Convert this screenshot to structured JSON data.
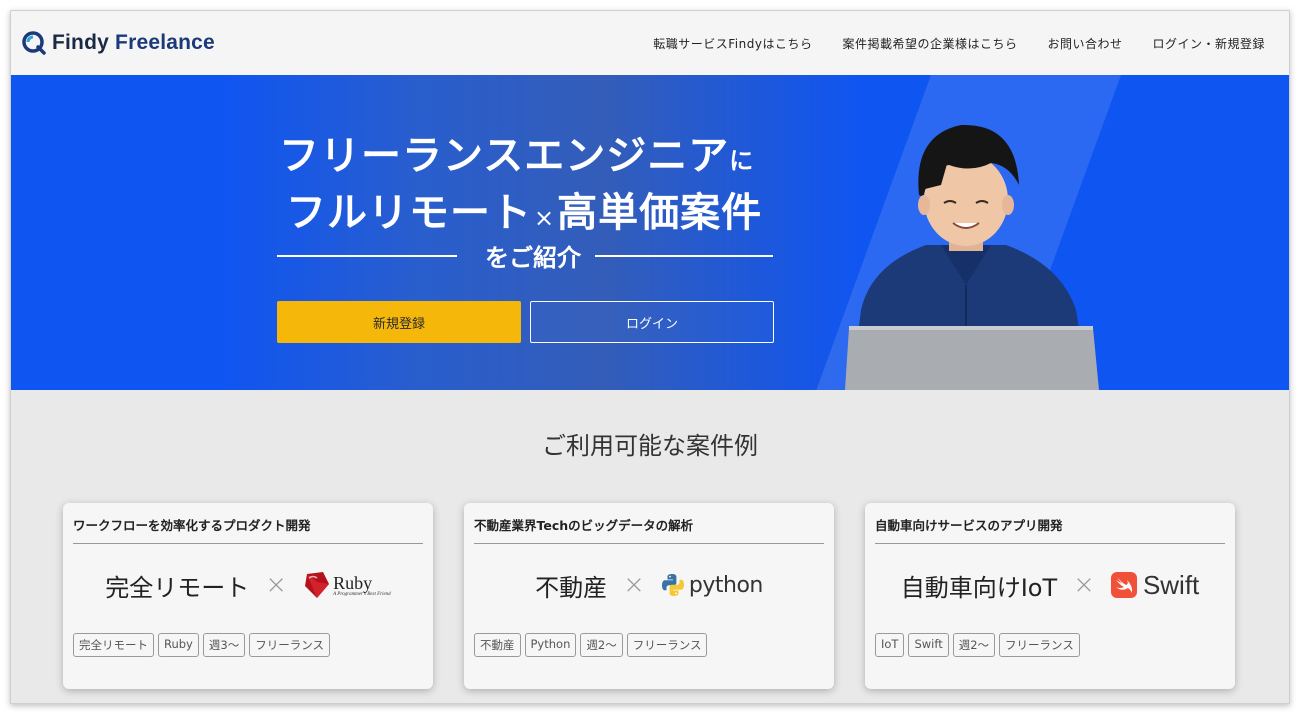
{
  "header": {
    "logo_part1": "Findy",
    "logo_part2": "Freelance",
    "nav": [
      "転職サービスFindyはこちら",
      "案件掲載希望の企業様はこちら",
      "お問い合わせ",
      "ログイン・新規登録"
    ]
  },
  "hero": {
    "title1_main": "フリーランスエンジニア",
    "title1_suffix": "に",
    "title2_left": "フルリモート",
    "title2_x": "×",
    "title2_right": "高単価案件",
    "subtitle": "をご紹介",
    "register_label": "新規登録",
    "login_label": "ログイン",
    "brand_color": "#0f55f2",
    "cta_color": "#f5b80a"
  },
  "section": {
    "title": "ご利用可能な案件例"
  },
  "cards": [
    {
      "title": "ワークフローを効率化するプロダクト開発",
      "term": "完全リモート",
      "times": "×",
      "logo": "ruby-logo",
      "logo_text": "Ruby",
      "logo_tagline": "A Programmer's Best Friend",
      "tags": [
        "完全リモート",
        "Ruby",
        "週3〜",
        "フリーランス"
      ]
    },
    {
      "title": "不動産業界Techのビッグデータの解析",
      "term": "不動産",
      "times": "×",
      "logo": "python-logo",
      "logo_text": "python",
      "tags": [
        "不動産",
        "Python",
        "週2〜",
        "フリーランス"
      ]
    },
    {
      "title": "自動車向けサービスのアプリ開発",
      "term": "自動車向けIoT",
      "times": "×",
      "logo": "swift-logo",
      "logo_text": "Swift",
      "tags": [
        "IoT",
        "Swift",
        "週2〜",
        "フリーランス"
      ]
    }
  ]
}
